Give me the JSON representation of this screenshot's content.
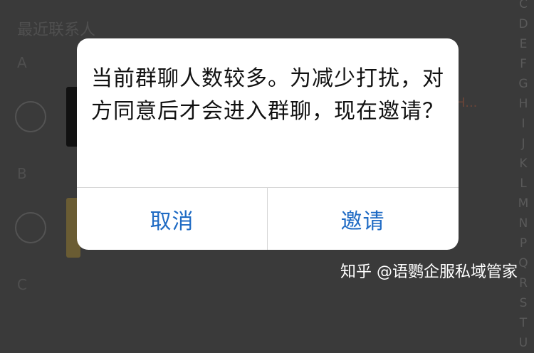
{
  "background": {
    "section_title": "最近联系人",
    "letters": [
      "A",
      "B",
      "C"
    ],
    "snippet": "H...",
    "index_letters": [
      "C",
      "D",
      "E",
      "F",
      "G",
      "H",
      "I",
      "J",
      "K",
      "L",
      "M",
      "N",
      "P",
      "Q",
      "R",
      "S",
      "T",
      "U"
    ]
  },
  "dialog": {
    "message": "当前群聊人数较多。为减少打扰，对方同意后才会进入群聊，现在邀请？",
    "cancel_label": "取消",
    "invite_label": "邀请"
  },
  "watermark": "知乎 @语鹦企服私域管家",
  "colors": {
    "accent": "#1f6bc4",
    "overlay": "#3a3a3a",
    "dialog_bg": "#ffffff"
  }
}
